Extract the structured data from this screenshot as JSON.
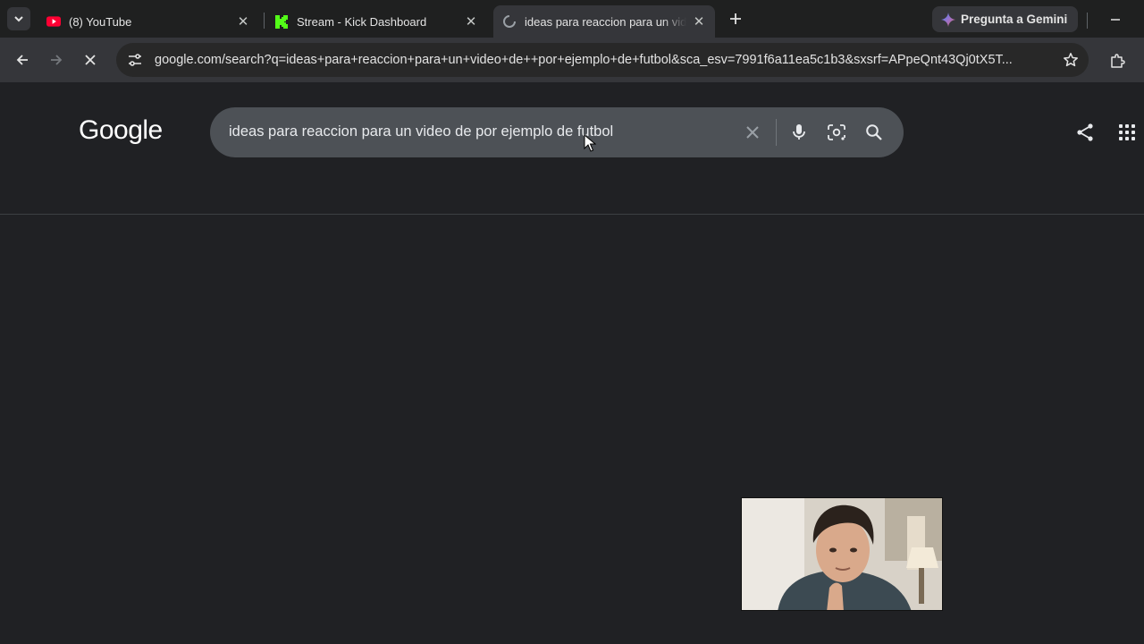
{
  "tabs": [
    {
      "title": "(8) YouTube",
      "icon": "youtube-icon"
    },
    {
      "title": "Stream - Kick Dashboard",
      "icon": "kick-icon"
    },
    {
      "title": "ideas para reaccion para un vid",
      "icon": "loading-icon",
      "active": true
    }
  ],
  "gemini_label": "Pregunta a Gemini",
  "address_bar": {
    "url": "google.com/search?q=ideas+para+reaccion+para+un+video+de++por+ejemplo+de+futbol&sca_esv=7991f6a11ea5c1b3&sxsrf=APpeQnt43Qj0tX5T..."
  },
  "google": {
    "logo": "Google",
    "query": "ideas para reaccion para un video de por ejemplo de futbol"
  },
  "colors": {
    "background": "#202124",
    "toolbar": "#35363a",
    "searchbox": "#4d5156"
  }
}
